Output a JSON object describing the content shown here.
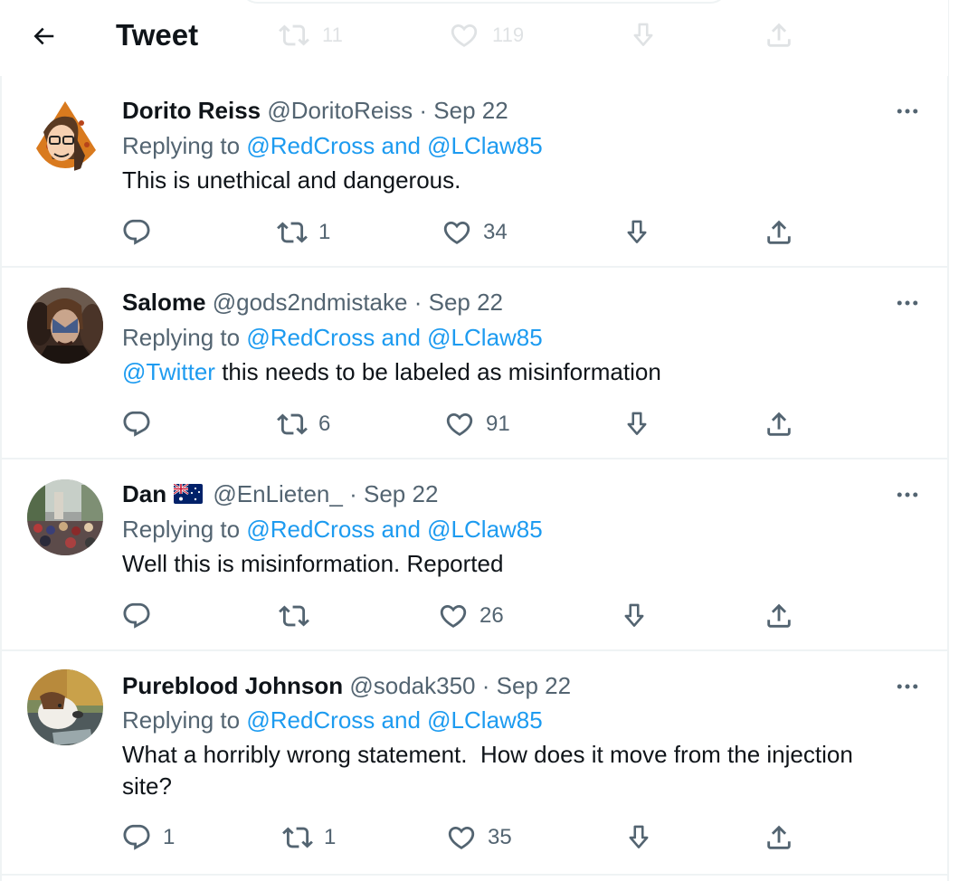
{
  "header": {
    "title": "Tweet",
    "faded_actions": {
      "retweets": "11",
      "likes": "119"
    }
  },
  "colors": {
    "link": "#1d9bf0",
    "secondary": "#536471",
    "primary_text": "#0f1419",
    "divider": "#eff3f4"
  },
  "replies": [
    {
      "name": "Dorito Reiss",
      "handle": "@DoritoReiss",
      "separator": "·",
      "date": "Sep 22",
      "replying_prefix": "Replying to",
      "replying_to_1": "@RedCross",
      "replying_and": "and",
      "replying_to_2": "@LClaw85",
      "text": "This is unethical and dangerous.",
      "counts": {
        "replies": "",
        "retweets": "1",
        "likes": "34"
      }
    },
    {
      "name": "Salome",
      "handle": "@gods2ndmistake",
      "separator": "·",
      "date": "Sep 22",
      "replying_prefix": "Replying to",
      "replying_to_1": "@RedCross",
      "replying_and": "and",
      "replying_to_2": "@LClaw85",
      "mention": "@Twitter",
      "text": "this needs to be labeled as misinformation",
      "counts": {
        "replies": "",
        "retweets": "6",
        "likes": "91"
      }
    },
    {
      "name": "Dan",
      "flag_icon": "australia-flag-icon",
      "handle": "@EnLieten_",
      "separator": "·",
      "date": "Sep 22",
      "replying_prefix": "Replying to",
      "replying_to_1": "@RedCross",
      "replying_and": "and",
      "replying_to_2": "@LClaw85",
      "text": "Well this is misinformation. Reported",
      "counts": {
        "replies": "",
        "retweets": "",
        "likes": "26"
      }
    },
    {
      "name": "Pureblood Johnson",
      "handle": "@sodak350",
      "separator": "·",
      "date": "Sep 22",
      "replying_prefix": "Replying to",
      "replying_to_1": "@RedCross",
      "replying_and": "and",
      "replying_to_2": "@LClaw85",
      "text": "What a horribly wrong statement.  How does it move from the injection site?",
      "counts": {
        "replies": "1",
        "retweets": "1",
        "likes": "35"
      }
    }
  ]
}
